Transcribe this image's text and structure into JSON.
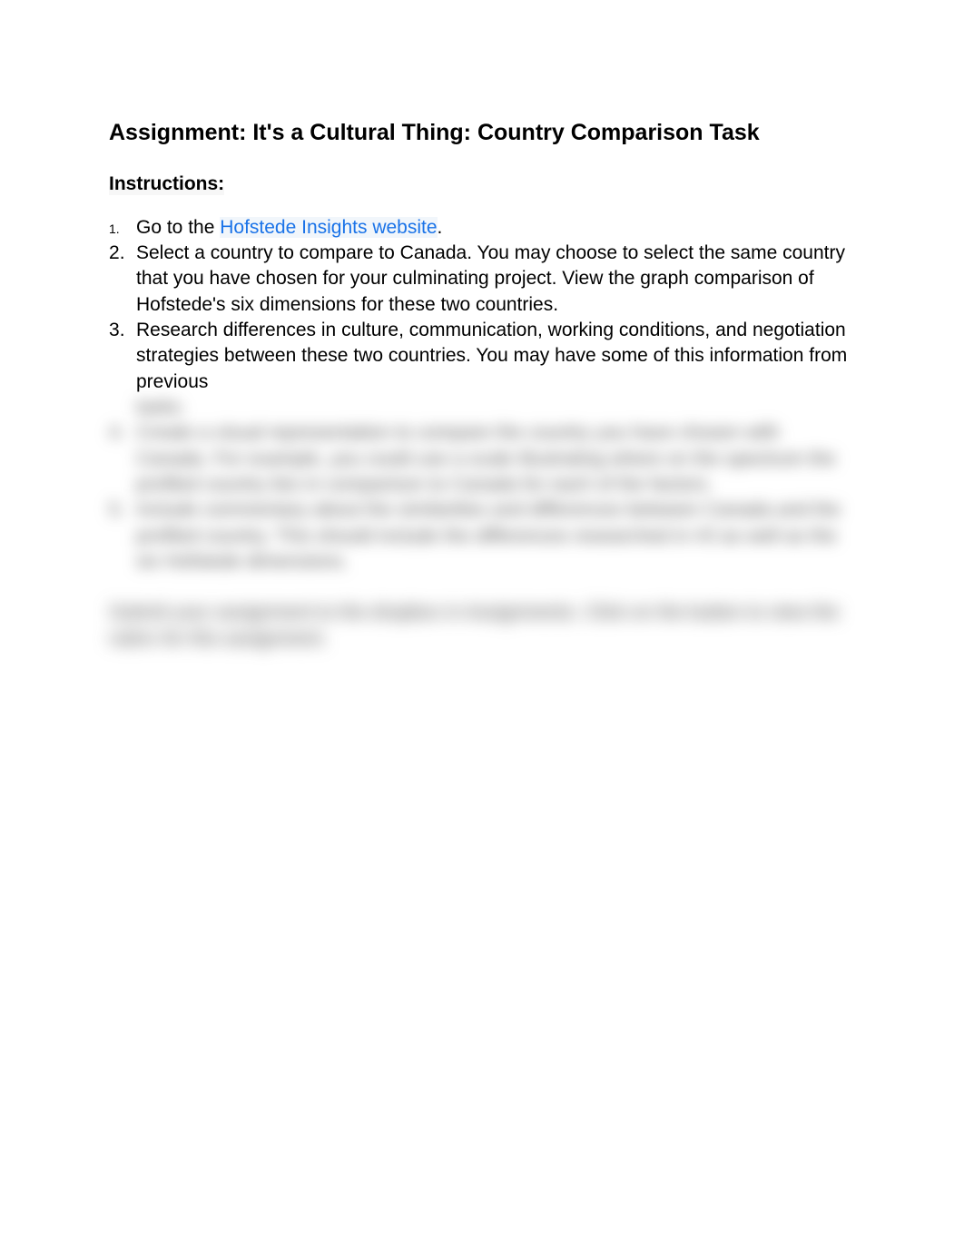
{
  "title": "Assignment: It's a Cultural Thing: Country Comparison Task",
  "instructions_label": "Instructions:",
  "items": {
    "item1_prefix": "Go to the ",
    "item1_link": "Hofstede Insights website",
    "item1_suffix": ".",
    "item2": "Select a country to compare to Canada. You may choose to select the same country that you have chosen for your culminating project.  View the graph comparison of Hofstede's six dimensions for these two countries.",
    "item3": "Research differences in culture, communication, working conditions, and negotiation strategies between these two countries. You may have some of this information from previous",
    "item3_blurred": "tasks.",
    "item4_blurred": "Create a visual representation to compare the country you have chosen with Canada. For example, you could use a scale illustrating where on the spectrum the profiled country lies in comparison to Canada for each of the factors.",
    "item5_blurred": "Include commentary about the similarities and differences between Canada and the profiled country. This should include the differences researched in #3 as well as the six Hofstede dimensions."
  },
  "footer_blurred": "Submit your assignment to the dropbox in Assignments. Click on the button to view the rubric for this assignment."
}
